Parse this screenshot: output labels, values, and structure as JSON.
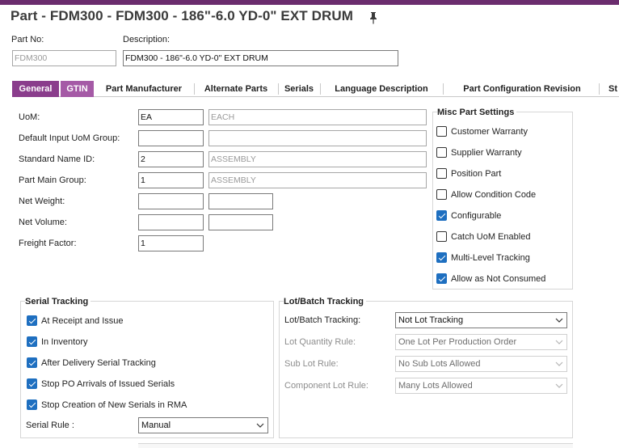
{
  "window": {
    "title": "Part - FDM300 - FDM300 - 186\"-6.0 YD-0\" EXT DRUM"
  },
  "header": {
    "part_no_label": "Part No:",
    "part_no_value": "FDM300",
    "description_label": "Description:",
    "description_value": "FDM300 - 186\"-6.0 YD-0\" EXT DRUM"
  },
  "tabs": [
    {
      "label": "General"
    },
    {
      "label": "GTIN"
    },
    {
      "label": "Part Manufacturer"
    },
    {
      "label": "Alternate Parts"
    },
    {
      "label": "Serials"
    },
    {
      "label": "Language Description"
    },
    {
      "label": "Part Configuration Revision"
    },
    {
      "label": "St"
    }
  ],
  "general": {
    "uom": {
      "label": "UoM:",
      "code": "EA",
      "desc": "EACH"
    },
    "default_input_uom_group": {
      "label": "Default Input UoM Group:",
      "code": "",
      "desc": ""
    },
    "standard_name_id": {
      "label": "Standard Name ID:",
      "code": "2",
      "desc": "ASSEMBLY"
    },
    "part_main_group": {
      "label": "Part Main Group:",
      "code": "1",
      "desc": "ASSEMBLY"
    },
    "net_weight": {
      "label": "Net Weight:",
      "value": "",
      "unit": ""
    },
    "net_volume": {
      "label": "Net Volume:",
      "value": "",
      "unit": ""
    },
    "freight_factor": {
      "label": "Freight Factor:",
      "value": "1"
    }
  },
  "misc_settings": {
    "title": "Misc Part Settings",
    "items": [
      {
        "label": "Customer Warranty",
        "checked": false
      },
      {
        "label": "Supplier Warranty",
        "checked": false
      },
      {
        "label": "Position Part",
        "checked": false
      },
      {
        "label": "Allow Condition Code",
        "checked": false
      },
      {
        "label": "Configurable",
        "checked": true
      },
      {
        "label": "Catch UoM Enabled",
        "checked": false
      },
      {
        "label": "Multi-Level Tracking",
        "checked": true
      },
      {
        "label": "Allow as Not Consumed",
        "checked": true
      }
    ]
  },
  "serial_tracking": {
    "title": "Serial Tracking",
    "items": [
      {
        "label": "At Receipt and Issue",
        "checked": true
      },
      {
        "label": "In Inventory",
        "checked": true
      },
      {
        "label": "After Delivery Serial Tracking",
        "checked": true
      },
      {
        "label": "Stop PO Arrivals of Issued Serials",
        "checked": true
      },
      {
        "label": "Stop Creation of New Serials in RMA",
        "checked": true
      }
    ],
    "serial_rule_label": "Serial Rule :",
    "serial_rule_value": "Manual"
  },
  "lot_batch_tracking": {
    "title": "Lot/Batch Tracking",
    "rows": [
      {
        "label": "Lot/Batch Tracking:",
        "value": "Not Lot Tracking",
        "enabled": true
      },
      {
        "label": "Lot Quantity Rule:",
        "value": "One Lot Per Production Order",
        "enabled": false
      },
      {
        "label": "Sub Lot Rule:",
        "value": "No Sub Lots Allowed",
        "enabled": false
      },
      {
        "label": "Component Lot Rule:",
        "value": "Many Lots Allowed",
        "enabled": false
      }
    ]
  },
  "colors": {
    "accent": "#8a3d8c",
    "topbar": "#6b2d6e",
    "checkbox": "#1e6fc0"
  }
}
